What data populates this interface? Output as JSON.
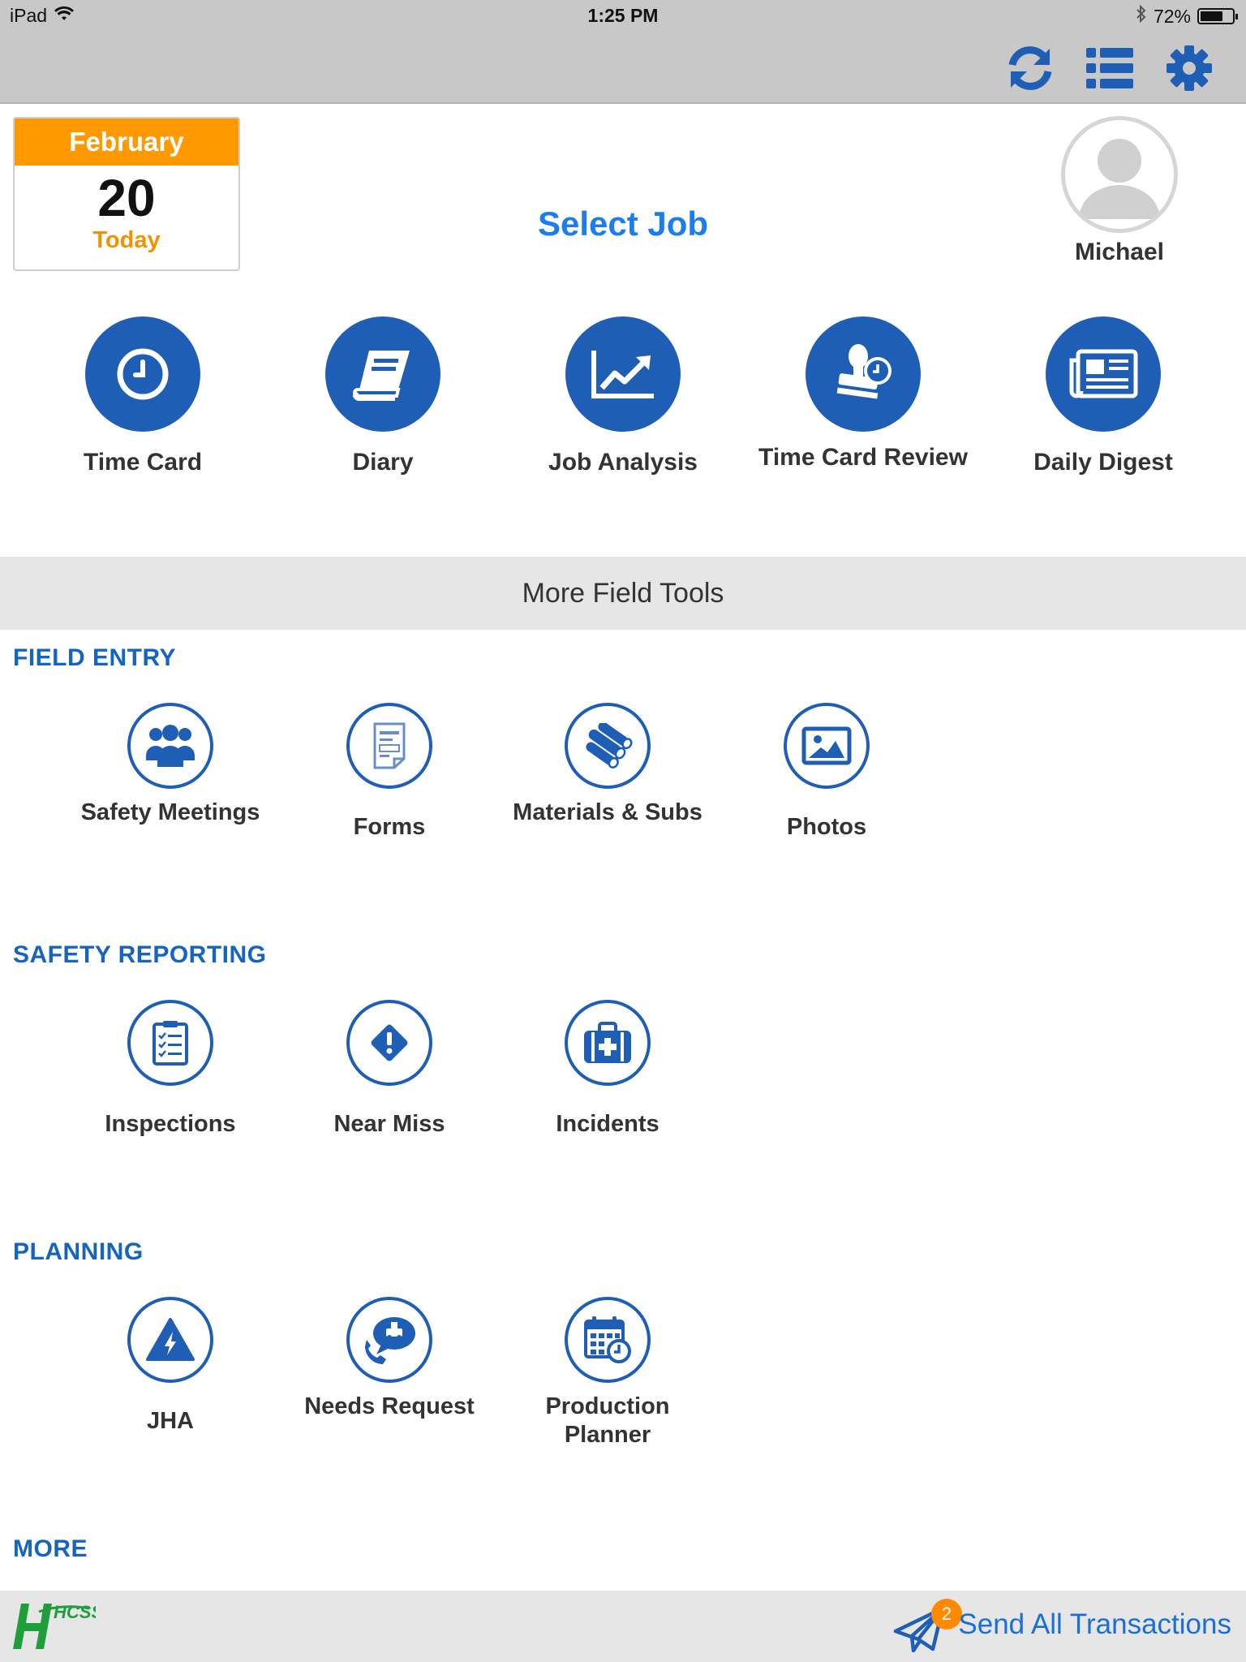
{
  "status_bar": {
    "device": "iPad",
    "time": "1:25 PM",
    "battery": "72%",
    "battery_level": 0.72,
    "icons": [
      "wifi-icon",
      "bluetooth-icon",
      "battery-icon"
    ]
  },
  "nav": {
    "icons": [
      "sync-icon",
      "list-icon",
      "gear-icon"
    ],
    "accent": "#1f5eb5"
  },
  "date_card": {
    "month": "February",
    "day": "20",
    "today": "Today",
    "accent": "#ff9900"
  },
  "select_job": "Select Job",
  "user": {
    "name": "Michael",
    "icon": "user-avatar-icon"
  },
  "primary_tools": [
    {
      "label": "Time Card",
      "icon": "clock-icon"
    },
    {
      "label": "Diary",
      "icon": "book-icon"
    },
    {
      "label": "Job Analysis",
      "icon": "chart-icon"
    },
    {
      "label": "Time Card Review",
      "icon": "stamp-icon"
    },
    {
      "label": "Daily Digest",
      "icon": "newspaper-icon"
    }
  ],
  "more_field_tools": "More Field Tools",
  "sections": [
    {
      "heading": "FIELD ENTRY",
      "items": [
        {
          "label": "Safety Meetings",
          "icon": "group-icon"
        },
        {
          "label": "Forms",
          "icon": "forms-icon"
        },
        {
          "label": "Materials & Subs",
          "icon": "pipes-icon"
        },
        {
          "label": "Photos",
          "icon": "photo-icon"
        }
      ]
    },
    {
      "heading": "SAFETY REPORTING",
      "items": [
        {
          "label": "Inspections",
          "icon": "checklist-icon"
        },
        {
          "label": "Near Miss",
          "icon": "warning-diamond-icon"
        },
        {
          "label": "Incidents",
          "icon": "first-aid-icon"
        }
      ]
    },
    {
      "heading": "PLANNING",
      "items": [
        {
          "label": "JHA",
          "icon": "hazard-triangle-icon"
        },
        {
          "label": "Needs Request",
          "icon": "phone-request-icon"
        },
        {
          "label": "Production Planner",
          "icon": "calendar-clock-icon"
        }
      ]
    },
    {
      "heading": "MORE",
      "items": []
    }
  ],
  "footer": {
    "logo_text": "HCSS",
    "send_label": "Send All Transactions",
    "badge_count": "2",
    "icon": "paper-plane-icon"
  }
}
